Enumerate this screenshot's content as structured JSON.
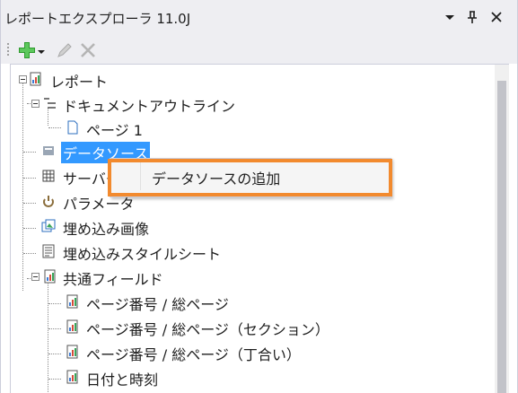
{
  "window": {
    "title": "レポートエクスプローラ 11.0J",
    "controls": {
      "dropdown": "▾",
      "pin": "⊥",
      "close": "✕"
    }
  },
  "toolbar": {
    "add_icon": "green-plus-icon",
    "add_dropdown": "▾",
    "edit_icon": "pencil-icon",
    "delete_icon": "delete-x-icon"
  },
  "tree": {
    "root": "レポート",
    "outline": "ドキュメントアウトライン",
    "page1": "ページ 1",
    "datasource": "データソース",
    "server": "サーバー",
    "params": "パラメータ",
    "images": "埋め込み画像",
    "stylesheets": "埋め込みスタイルシート",
    "common_fields": "共通フィールド",
    "fields": [
      "ページ番号 / 総ページ",
      "ページ番号 / 総ページ（セクション）",
      "ページ番号 / 総ページ（丁合い）",
      "日付と時刻"
    ]
  },
  "context_menu": {
    "add_datasource": "データソースの追加"
  },
  "colors": {
    "selection": "#3399ff",
    "highlight_border": "#f28a2e",
    "panel_bg": "#eeeef2"
  }
}
